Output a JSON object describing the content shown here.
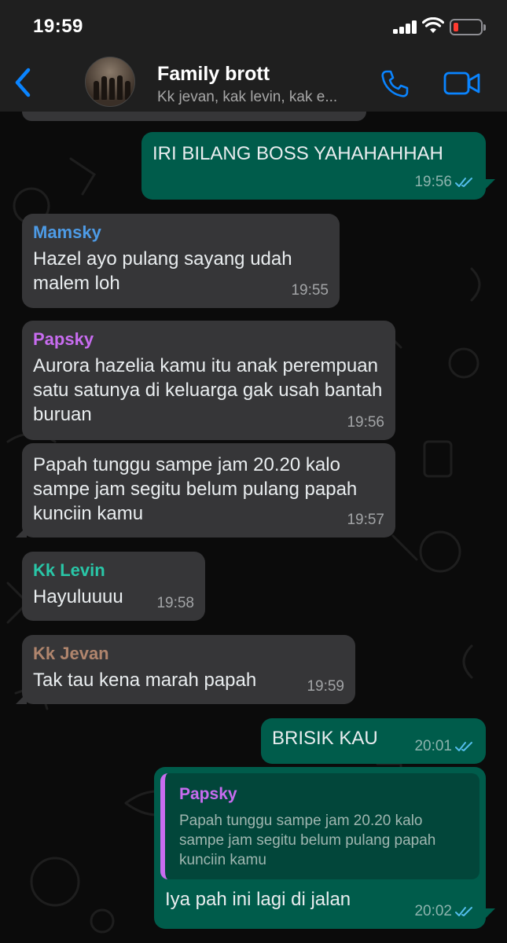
{
  "status_bar": {
    "time": "19:59"
  },
  "header": {
    "title": "Family brott",
    "subtitle": "Kk jevan, kak levin, kak e..."
  },
  "colors": {
    "sender_mamsky": "#4d9be6",
    "sender_papsky": "#c86cf0",
    "sender_kk_levin": "#29c6a7",
    "sender_kk_jevan": "#b0856d",
    "outgoing_bubble": "#005c4b",
    "incoming_bubble": "#363638",
    "read_ticks": "#53bdeb",
    "accent_blue": "#0a84ff"
  },
  "messages": [
    {
      "direction": "out",
      "text": "IRI BILANG BOSS YAHAHAHHAH",
      "time": "19:56",
      "read": true
    },
    {
      "direction": "in",
      "sender": "Mamsky",
      "text": "Hazel ayo pulang sayang udah malem loh",
      "time": "19:55"
    },
    {
      "direction": "in",
      "sender": "Papsky",
      "text": "Aurora hazelia kamu itu anak perempuan satu satunya di keluarga gak usah bantah buruan",
      "time": "19:56"
    },
    {
      "direction": "in",
      "text": "Papah tunggu sampe jam 20.20 kalo sampe jam segitu belum pulang papah kunciin kamu",
      "time": "19:57"
    },
    {
      "direction": "in",
      "sender": "Kk Levin",
      "text": "Hayuluuuu",
      "time": "19:58"
    },
    {
      "direction": "in",
      "sender": "Kk Jevan",
      "text": "Tak tau kena marah papah",
      "time": "19:59"
    },
    {
      "direction": "out",
      "text": "BRISIK KAU",
      "time": "20:01",
      "read": true
    },
    {
      "direction": "out",
      "quote": {
        "sender": "Papsky",
        "text": "Papah tunggu sampe jam 20.20 kalo sampe jam segitu belum pulang papah kunciin kamu"
      },
      "text": "Iya pah ini lagi di jalan",
      "time": "20:02",
      "read": true
    }
  ]
}
